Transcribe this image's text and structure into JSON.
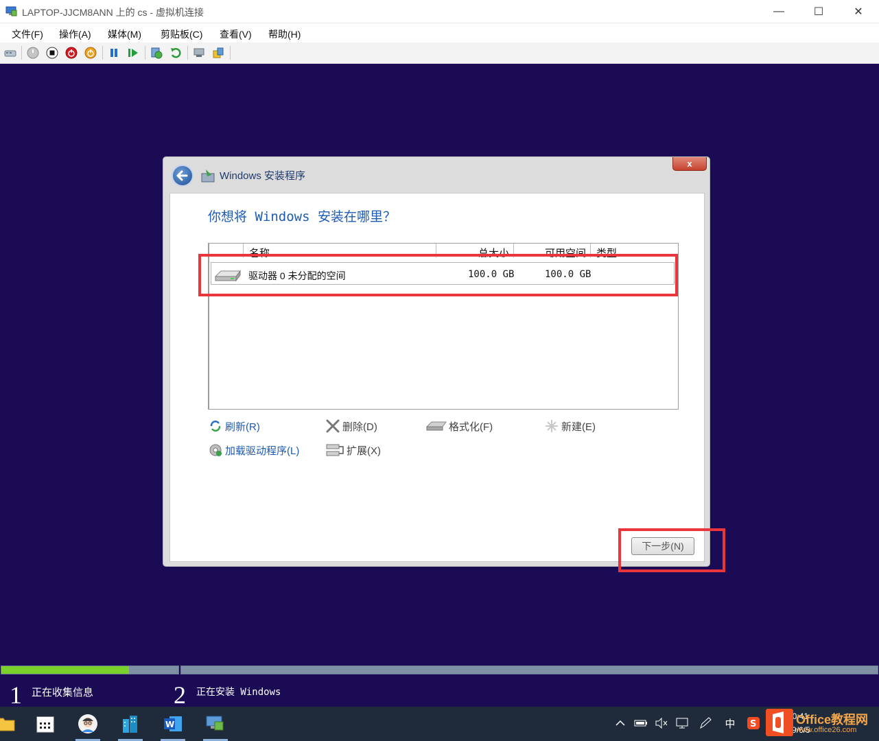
{
  "window": {
    "title": "LAPTOP-JJCM8ANN 上的 cs - 虚拟机连接",
    "controls": {
      "minimize": "—",
      "maximize": "☐",
      "close": "✕"
    }
  },
  "menu": [
    "文件(F)",
    "操作(A)",
    "媒体(M)",
    "剪贴板(C)",
    "查看(V)",
    "帮助(H)"
  ],
  "toolbar_icons": [
    "ctrl-alt-del-icon",
    "start-icon",
    "turn-off-icon",
    "shutdown-icon",
    "save-icon",
    "pause-icon",
    "resume-icon",
    "checkpoint-icon",
    "revert-icon",
    "enhanced-session-icon",
    "share-icon"
  ],
  "setup": {
    "title": "Windows 安装程序",
    "close_label": "x",
    "heading": "你想将 Windows 安装在哪里？",
    "columns": {
      "name": "名称",
      "total": "总大小",
      "free": "可用空间",
      "type": "类型"
    },
    "rows": [
      {
        "name": "驱动器 0 未分配的空间",
        "total": "100.0 GB",
        "free": "100.0 GB",
        "type": ""
      }
    ],
    "actions": {
      "refresh": "刷新(R)",
      "delete": "删除(D)",
      "format": "格式化(F)",
      "new": "新建(E)",
      "load_driver": "加载驱动程序(L)",
      "extend": "扩展(X)"
    },
    "next_label": "下一步(N)"
  },
  "progress": {
    "step1": {
      "number": "1",
      "label": "正在收集信息"
    },
    "step2": {
      "number": "2",
      "label": "正在安装 Windows"
    },
    "step1_fill_fraction": 0.72
  },
  "taskbar": {
    "apps": [
      "file-explorer-icon",
      "calendar-icon",
      "avatar-app-icon",
      "buildings-app-icon",
      "word-icon",
      "vm-connection-icon"
    ],
    "tray": {
      "ime": "中",
      "clock_time": "10:41",
      "clock_date": "2019/6/5"
    }
  },
  "watermark": {
    "text": "Office教程网",
    "sub": "www.office26.com"
  },
  "colors": {
    "vm_bg": "#1b0b55",
    "highlight": "#e8363c",
    "progress_fill": "#7bd12b",
    "link_blue": "#1d5bb3"
  }
}
